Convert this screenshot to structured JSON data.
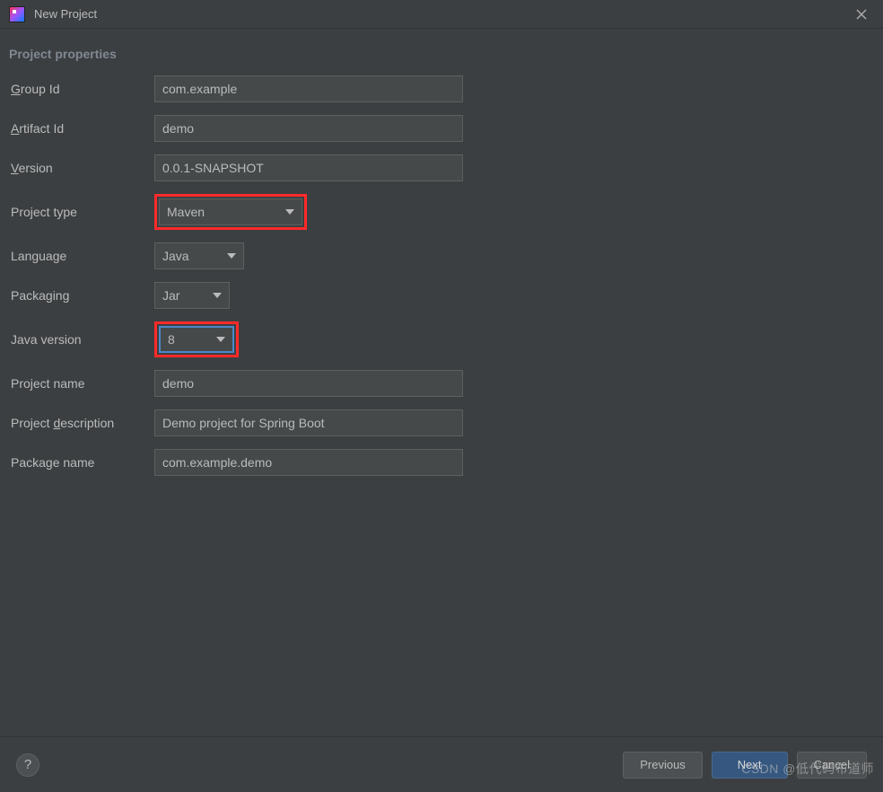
{
  "window": {
    "title": "New Project"
  },
  "section": {
    "heading": "Project properties"
  },
  "labels": {
    "group_id_pre": "",
    "group_id_mn": "G",
    "group_id_post": "roup Id",
    "artifact_id_pre": "",
    "artifact_id_mn": "A",
    "artifact_id_post": "rtifact Id",
    "version_pre": "",
    "version_mn": "V",
    "version_post": "ersion",
    "project_type": "Project type",
    "language": "Language",
    "packaging": "Packaging",
    "java_version": "Java version",
    "project_name": "Project name",
    "project_desc_pre": "Project ",
    "project_desc_mn": "d",
    "project_desc_post": "escription",
    "package_name_pre": "Packa",
    "package_name_mn": "g",
    "package_name_post": "e name"
  },
  "fields": {
    "group_id": "com.example",
    "artifact_id": "demo",
    "version": "0.0.1-SNAPSHOT",
    "project_type": "Maven",
    "language": "Java",
    "packaging": "Jar",
    "java_version": "8",
    "project_name": "demo",
    "project_description": "Demo project for Spring Boot",
    "package_name": "com.example.demo"
  },
  "footer": {
    "previous": "Previous",
    "next": "Next",
    "cancel": "Cancel"
  },
  "watermark": "CSDN @低代码布道师"
}
